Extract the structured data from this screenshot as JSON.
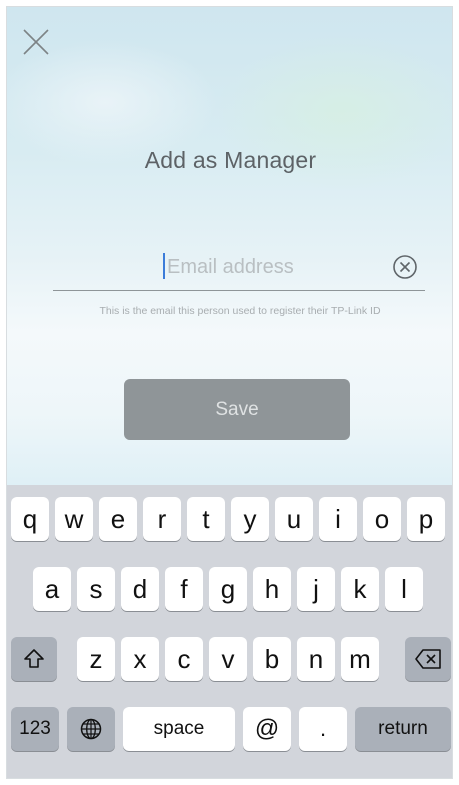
{
  "header": {
    "close_icon": "close-icon",
    "title": "Add as Manager"
  },
  "form": {
    "email_placeholder": "Email address",
    "email_value": "",
    "clear_icon": "clear-circle-icon",
    "hint": "This is the email this person used to register their TP-Link ID",
    "save_label": "Save"
  },
  "keyboard": {
    "row1": [
      "q",
      "w",
      "e",
      "r",
      "t",
      "y",
      "u",
      "i",
      "o",
      "p"
    ],
    "row2": [
      "a",
      "s",
      "d",
      "f",
      "g",
      "h",
      "j",
      "k",
      "l"
    ],
    "row3": [
      "z",
      "x",
      "c",
      "v",
      "b",
      "n",
      "m"
    ],
    "shift_icon": "shift-icon",
    "backspace_icon": "backspace-icon",
    "numbers_label": "123",
    "globe_icon": "globe-icon",
    "space_label": "space",
    "at_label": "@",
    "dot_label": ".",
    "return_label": "return"
  },
  "colors": {
    "save_button_bg": "#8f9598",
    "keyboard_bg": "#d2d5db",
    "function_key_bg": "#aab0b9",
    "caret": "#3c7cd9"
  }
}
